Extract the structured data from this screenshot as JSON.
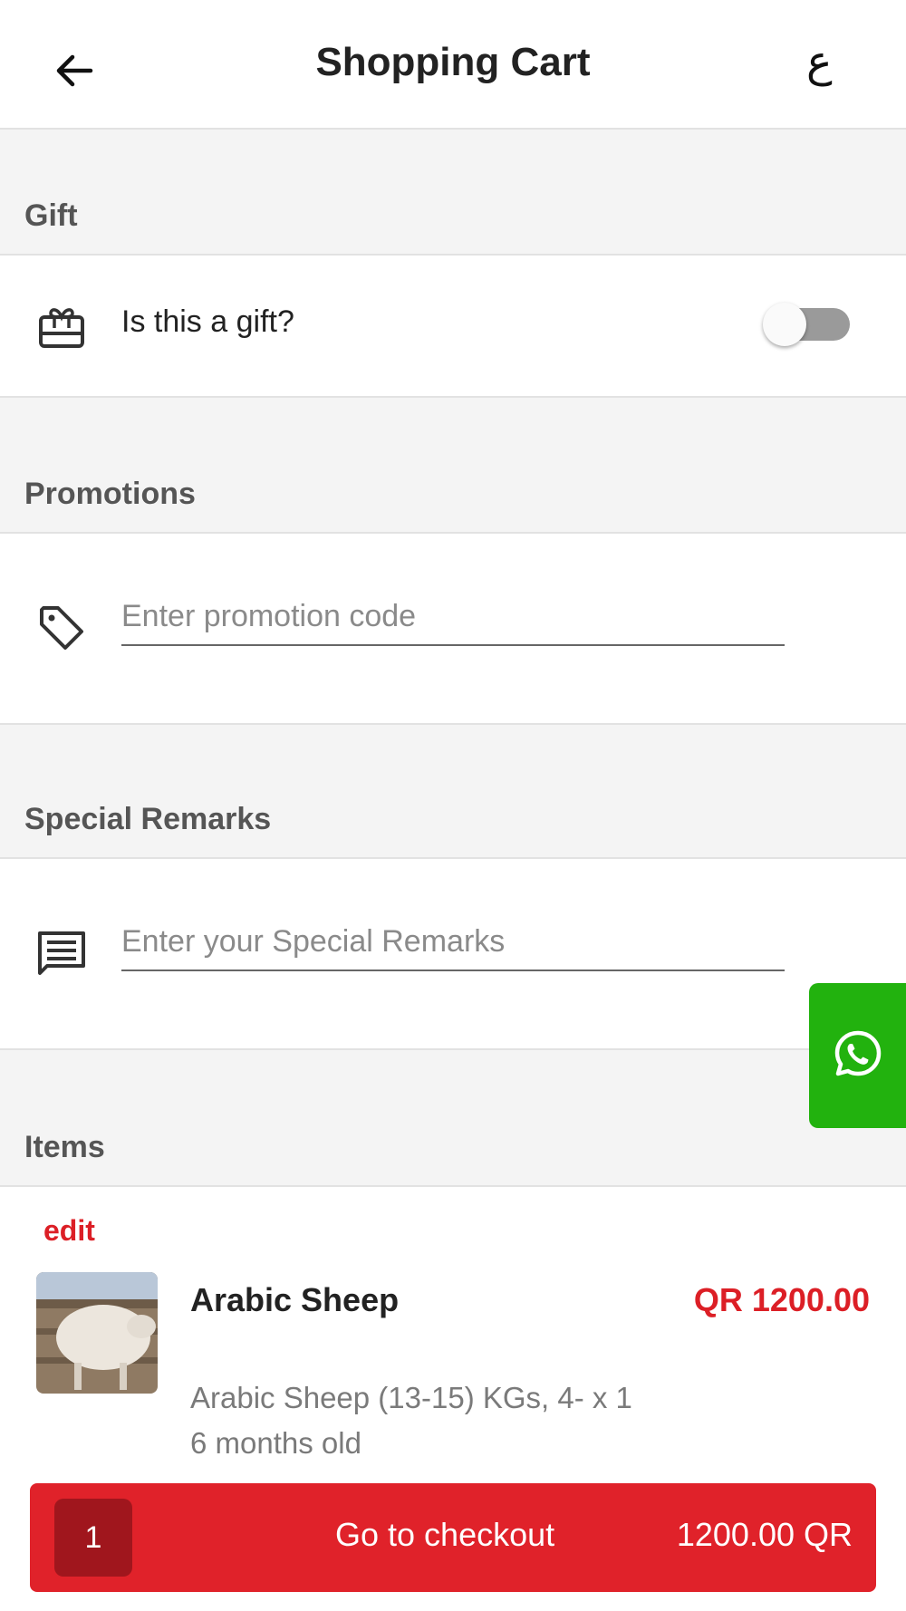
{
  "header": {
    "title": "Shopping Cart",
    "language_toggle": "ع",
    "back_icon": "arrow-left-icon"
  },
  "gift": {
    "section_title": "Gift",
    "label": "Is this a gift?",
    "icon": "gift-card-icon",
    "enabled": false
  },
  "promotions": {
    "section_title": "Promotions",
    "placeholder": "Enter promotion code",
    "value": "",
    "icon": "tag-icon"
  },
  "remarks": {
    "section_title": "Special Remarks",
    "placeholder": "Enter your Special Remarks",
    "value": "",
    "icon": "comment-icon"
  },
  "whatsapp": {
    "icon": "whatsapp-icon",
    "color": "#22b20e"
  },
  "items": {
    "section_title": "Items",
    "edit_label": "edit",
    "list": [
      {
        "name": "Arabic Sheep",
        "price": "QR 1200.00",
        "description": "Arabic Sheep (13-15) KGs, 4- x 1",
        "age": "6 months old"
      }
    ]
  },
  "checkout": {
    "quantity": "1",
    "label": "Go to checkout",
    "total": "1200.00 QR",
    "color": "#e0222a"
  },
  "colors": {
    "accent": "#dc1f26",
    "section_bg": "#f4f4f4"
  }
}
